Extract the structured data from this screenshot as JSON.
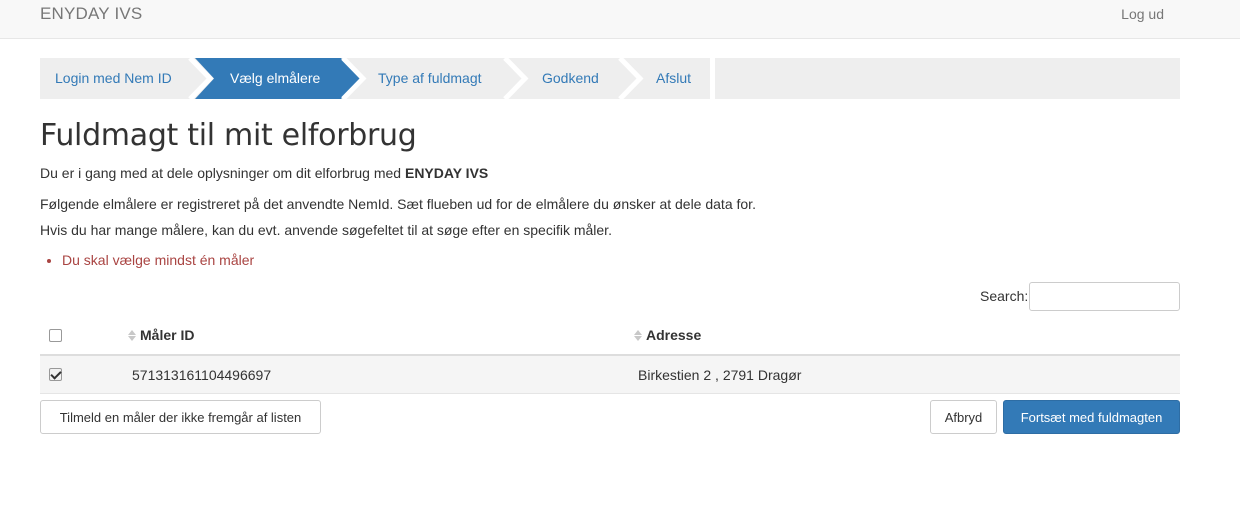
{
  "header": {
    "brand": "ENYDAY IVS",
    "logout_label": "Log ud"
  },
  "wizard": {
    "steps": [
      {
        "label": "Login med Nem ID",
        "state": "completed"
      },
      {
        "label": "Vælg elmålere",
        "state": "active"
      },
      {
        "label": "Type af fuldmagt",
        "state": "pending"
      },
      {
        "label": "Godkend",
        "state": "pending"
      },
      {
        "label": "Afslut",
        "state": "pending"
      }
    ],
    "colors": {
      "inactive_bg": "#eeeeee",
      "active_bg": "#337ab7",
      "separator": "#ffffff"
    }
  },
  "main": {
    "title": "Fuldmagt til mit elforbrug",
    "intro_prefix": "Du er i gang med at dele oplysninger om dit elforbrug med ",
    "intro_company": "ENYDAY IVS",
    "paragraph1": "Følgende elmålere er registreret på det anvendte NemId. Sæt flueben ud for de elmålere du ønsker at dele data for.",
    "paragraph2": "Hvis du har mange målere, kan du evt. anvende søgefeltet til at søge efter en specifik måler.",
    "errors": [
      "Du skal vælge mindst én måler"
    ]
  },
  "search": {
    "label": "Search:",
    "value": ""
  },
  "table": {
    "select_all_checked": false,
    "columns": [
      "Måler ID",
      "Adresse"
    ],
    "rows": [
      {
        "checked": true,
        "meter_id": "571313161104496697",
        "address": "Birkestien 2 , 2791 Dragør"
      }
    ]
  },
  "actions": {
    "register_label": "Tilmeld en måler der ikke fremgår af listen",
    "cancel_label": "Afbryd",
    "continue_label": "Fortsæt med fuldmagten"
  },
  "colors": {
    "primary": "#337ab7",
    "error": "#a94442",
    "navbar_bg": "#f8f8f8"
  }
}
